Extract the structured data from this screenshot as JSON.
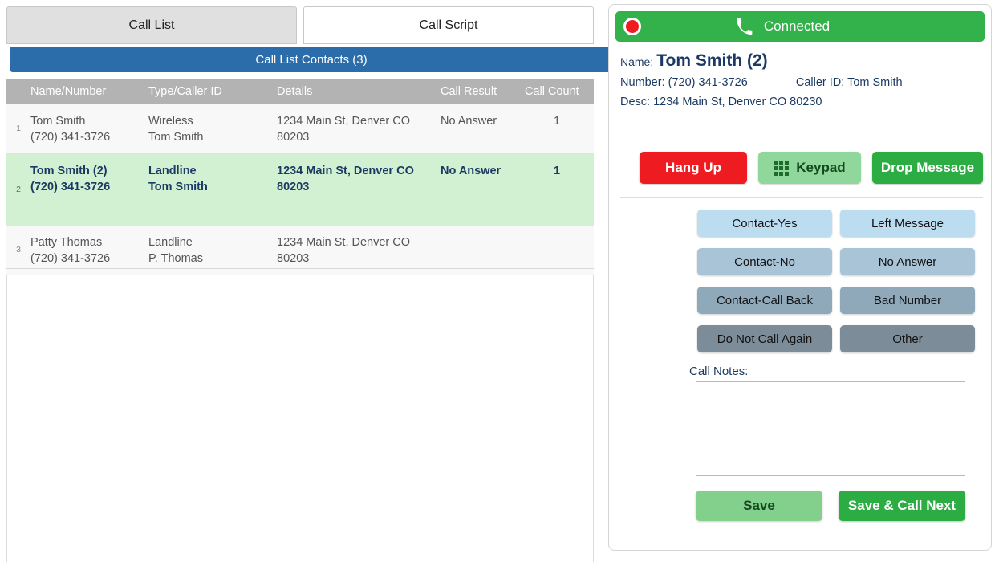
{
  "tabs": [
    {
      "label": "Call List",
      "active": true
    },
    {
      "label": "Call Script",
      "active": false
    }
  ],
  "call_list": {
    "title": "Call List Contacts (3)",
    "columns": [
      "Name/Number",
      "Type/Caller ID",
      "Details",
      "Call Result",
      "Call Count"
    ],
    "rows": [
      {
        "index": "1",
        "name": "Tom Smith",
        "number": "(720) 341-3726",
        "type": "Wireless",
        "caller_id": "Tom Smith",
        "details_line1": "1234 Main St, Denver CO",
        "details_line2": "80203",
        "call_result": "No Answer",
        "call_count": "1",
        "selected": false
      },
      {
        "index": "2",
        "name": "Tom Smith (2)",
        "number": "(720) 341-3726",
        "type": "Landline",
        "caller_id": "Tom Smith",
        "details_line1": "1234 Main St, Denver CO",
        "details_line2": "80203",
        "call_result": "No Answer",
        "call_count": "1",
        "selected": true
      },
      {
        "index": "3",
        "name": "Patty Thomas",
        "number": "(720) 341-3726",
        "type": "Landline",
        "caller_id": "P. Thomas",
        "details_line1": "1234 Main St, Denver CO",
        "details_line2": "80203",
        "call_result": "",
        "call_count": "",
        "selected": false
      }
    ]
  },
  "call_panel": {
    "status": {
      "label": "Connected",
      "record_icon": "record-dot-icon",
      "phone_icon": "phone-handset-icon",
      "bar_color": "#33b24b",
      "record_color": "#ee1c21"
    },
    "contact": {
      "name_label": "Name:",
      "name_value": "Tom Smith (2)",
      "number_label": "Number:",
      "number_value": "(720) 341-3726",
      "caller_id_label": "Caller ID:",
      "caller_id_value": "Tom Smith",
      "desc_label": "Desc:",
      "desc_value": "1234 Main St, Denver CO 80230"
    },
    "actions": {
      "hang_up": "Hang Up",
      "keypad": "Keypad",
      "keypad_icon": "keypad-grid-icon",
      "drop_message": "Drop Message"
    },
    "dispositions": [
      {
        "label": "Contact-Yes",
        "level": "lvl1"
      },
      {
        "label": "Left Message",
        "level": "lvl1"
      },
      {
        "label": "Contact-No",
        "level": "lvl2"
      },
      {
        "label": "No Answer",
        "level": "lvl2"
      },
      {
        "label": "Contact-Call Back",
        "level": "lvl3"
      },
      {
        "label": "Bad Number",
        "level": "lvl3"
      },
      {
        "label": "Do Not Call Again",
        "level": "lvl4"
      },
      {
        "label": "Other",
        "level": "lvl4"
      }
    ],
    "notes": {
      "label": "Call Notes:",
      "value": "",
      "placeholder": ""
    },
    "footer": {
      "save": "Save",
      "save_call_next": "Save & Call Next"
    }
  }
}
